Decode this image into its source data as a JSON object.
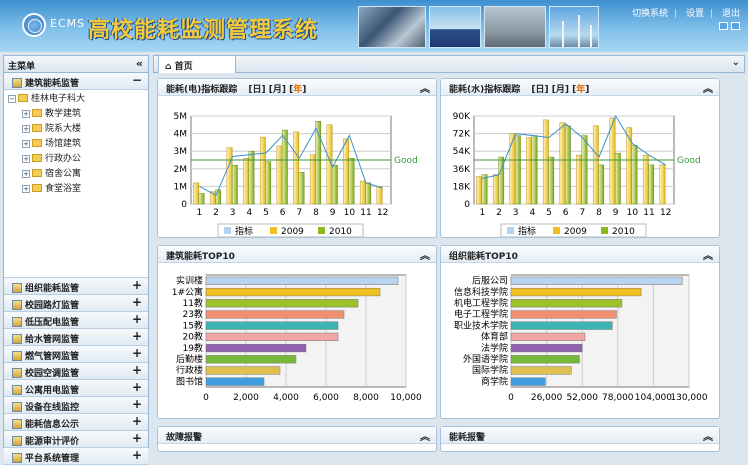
{
  "app": {
    "ecms": "ECMS",
    "title": "高校能耗监测管理系统"
  },
  "toplinks": {
    "switch": "切换系统",
    "settings": "设置",
    "logout": "退出"
  },
  "sidebar": {
    "title": "主菜单",
    "open_section": "建筑能耗监管",
    "tree_root": "桂林电子科大",
    "tree_items": [
      "教学建筑",
      "院系大楼",
      "场馆建筑",
      "行政办公",
      "宿舍公寓",
      "食堂浴室"
    ],
    "sections": [
      "组织能耗监管",
      "校园路灯监管",
      "低压配电监管",
      "给水管网监管",
      "燃气管网监管",
      "校园空调监管",
      "公寓用电监管",
      "设备在线监控",
      "能耗信息公示",
      "能源审计评价",
      "平台系统管理"
    ]
  },
  "tabs": {
    "home": "首页"
  },
  "panels": {
    "elec": {
      "title": "能耗(电)指标跟踪",
      "periods": [
        "日",
        "月",
        "年"
      ],
      "active": "年"
    },
    "water": {
      "title": "能耗(水)指标跟踪",
      "periods": [
        "日",
        "月",
        "年"
      ],
      "active": "年"
    },
    "build_top": {
      "title": "建筑能耗TOP10"
    },
    "org_top": {
      "title": "组织能耗TOP10"
    },
    "fault": {
      "title": "故障报警"
    },
    "energy_alarm": {
      "title": "能耗报警"
    }
  },
  "colors": {
    "index": "#b3d4f0",
    "y2009": "#f0c020",
    "y2010": "#8cb820",
    "good": "#3a9a3a",
    "line": "#3b8fd0"
  },
  "chart_data": [
    {
      "type": "bar",
      "categories": [
        "1",
        "2",
        "3",
        "4",
        "5",
        "6",
        "7",
        "8",
        "9",
        "10",
        "11",
        "12"
      ],
      "yticks": [
        "0",
        "1M",
        "2M",
        "3M",
        "4M",
        "5M"
      ],
      "ylim": [
        0,
        5000000
      ],
      "reference_label": "Good",
      "reference": 2500000,
      "series": [
        {
          "name": "指标",
          "values": [
            0,
            0,
            0,
            0,
            0,
            0,
            0,
            0,
            0,
            0,
            0,
            0
          ]
        },
        {
          "name": "2009",
          "values": [
            1200000,
            700000,
            3200000,
            2600000,
            3800000,
            3300000,
            4100000,
            2800000,
            4500000,
            3700000,
            1300000,
            1000000
          ]
        },
        {
          "name": "2010",
          "values": [
            600000,
            800000,
            2200000,
            3000000,
            2400000,
            4200000,
            1800000,
            4700000,
            2200000,
            2600000,
            1200000,
            0
          ]
        }
      ],
      "line": [
        1000000,
        500000,
        2700000,
        2800000,
        2900000,
        3900000,
        2600000,
        4300000,
        2100000,
        3900000,
        1200000,
        900000
      ]
    },
    {
      "type": "bar",
      "categories": [
        "1",
        "2",
        "3",
        "4",
        "5",
        "6",
        "7",
        "8",
        "9",
        "10",
        "11",
        "12"
      ],
      "yticks": [
        "0",
        "18K",
        "36K",
        "54K",
        "72K",
        "90K"
      ],
      "ylim": [
        0,
        90000
      ],
      "reference_label": "Good",
      "reference": 45000,
      "series": [
        {
          "name": "指标",
          "values": [
            0,
            0,
            0,
            0,
            0,
            0,
            0,
            0,
            0,
            0,
            0,
            0
          ]
        },
        {
          "name": "2009",
          "values": [
            28000,
            30000,
            72000,
            68000,
            86000,
            83000,
            50000,
            80000,
            88000,
            78000,
            50000,
            40000
          ]
        },
        {
          "name": "2010",
          "values": [
            30000,
            48000,
            70000,
            70000,
            48000,
            80000,
            70000,
            40000,
            52000,
            60000,
            40000,
            0
          ]
        }
      ],
      "line": [
        26000,
        30000,
        72000,
        70000,
        68000,
        82000,
        68000,
        48000,
        90000,
        62000,
        50000,
        40000
      ]
    },
    {
      "type": "bar",
      "orientation": "horizontal",
      "categories": [
        "实训楼",
        "1#公寓",
        "11教",
        "23教",
        "15教",
        "20教",
        "19教",
        "后勤楼",
        "行政楼",
        "图书馆"
      ],
      "values": [
        9600,
        8700,
        7600,
        6900,
        6600,
        6600,
        5000,
        4500,
        3700,
        2900
      ],
      "xticks": [
        "0",
        "2,000",
        "4,000",
        "6,000",
        "8,000",
        "10,000"
      ],
      "xlim": [
        0,
        10000
      ],
      "colors": [
        "#b8d4ee",
        "#f0c020",
        "#9cc22a",
        "#f09070",
        "#3cb4b4",
        "#f2a6a6",
        "#9060b0",
        "#78b838",
        "#e0c050",
        "#3f9ee0"
      ]
    },
    {
      "type": "bar",
      "orientation": "horizontal",
      "categories": [
        "后服公司",
        "信息科技学院",
        "机电工程学院",
        "电子工程学院",
        "职业技术学院",
        "体育部",
        "法学院",
        "外国语学院",
        "国际学院",
        "商学院"
      ],
      "values": [
        125000,
        95000,
        81000,
        77000,
        74000,
        54000,
        52000,
        50000,
        44000,
        25000
      ],
      "xticks": [
        "0",
        "26,000",
        "52,000",
        "78,000",
        "104,000",
        "130,000"
      ],
      "xlim": [
        0,
        130000
      ],
      "colors": [
        "#b8d4ee",
        "#f0c020",
        "#9cc22a",
        "#f09070",
        "#3cb4b4",
        "#f2a6a6",
        "#9060b0",
        "#78b838",
        "#e0c050",
        "#3f9ee0"
      ]
    }
  ]
}
